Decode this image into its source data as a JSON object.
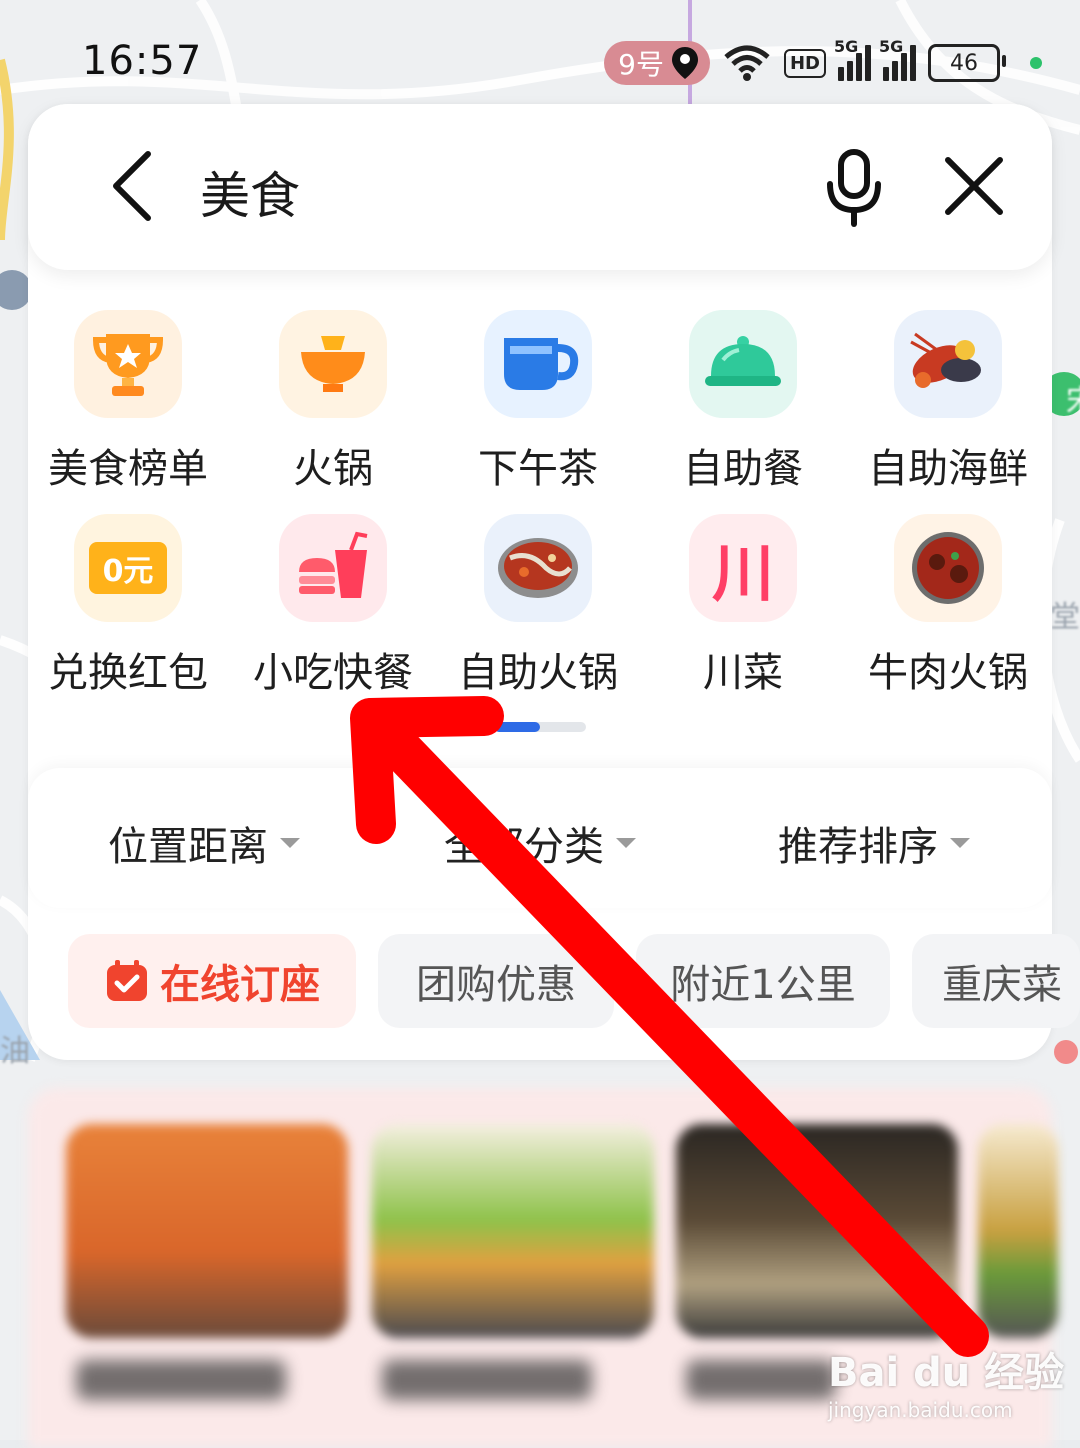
{
  "status_bar": {
    "time": "16:57",
    "nav_pill": "9号",
    "signal_1": "5G",
    "signal_2": "5G",
    "hd": "HD",
    "battery": "46"
  },
  "search": {
    "query": "美食",
    "icons": [
      "back-arrow-icon",
      "microphone-icon",
      "close-icon"
    ]
  },
  "categories": [
    {
      "label": "美食榜单",
      "icon": "trophy-icon",
      "bg": "#fff1e0"
    },
    {
      "label": "火锅",
      "icon": "hotpot-icon",
      "bg": "#fff3e2"
    },
    {
      "label": "下午茶",
      "icon": "teacup-icon",
      "bg": "#e7f2ff"
    },
    {
      "label": "自助餐",
      "icon": "food-cloche-icon",
      "bg": "#e3f7f1"
    },
    {
      "label": "自助海鲜",
      "icon": "seafood-icon",
      "bg": "#eaf1fb"
    },
    {
      "label": "兑换红包",
      "icon": "coupon-icon",
      "bg": "#fff4df"
    },
    {
      "label": "小吃快餐",
      "icon": "burger-drink-icon",
      "bg": "#ffe9ec"
    },
    {
      "label": "自助火锅",
      "icon": "hotpot-pot-icon",
      "bg": "#eaf1fb"
    },
    {
      "label": "川菜",
      "icon": "sichuan-char-icon",
      "bg": "#ffecee"
    },
    {
      "label": "牛肉火锅",
      "icon": "beef-hotpot-icon",
      "bg": "#fff3e6"
    }
  ],
  "coupon_text": "0元",
  "sichuan_text": "川",
  "filters": [
    {
      "label": "位置距离"
    },
    {
      "label": "全部分类"
    },
    {
      "label": "推荐排序"
    }
  ],
  "chips": [
    {
      "label": "在线订座",
      "icon": "calendar-check-icon"
    },
    {
      "label": "团购优惠"
    },
    {
      "label": "附近1公里"
    },
    {
      "label": "重庆菜"
    }
  ],
  "map_labels": [
    "堂",
    "油",
    "宋"
  ],
  "watermark": {
    "brand": "Bai du 经验",
    "url": "jingyan.baidu.com"
  },
  "colors": {
    "accent_blue": "#2e6be6",
    "chip_active": "#f0442e",
    "arrow_red": "#ff0000"
  }
}
